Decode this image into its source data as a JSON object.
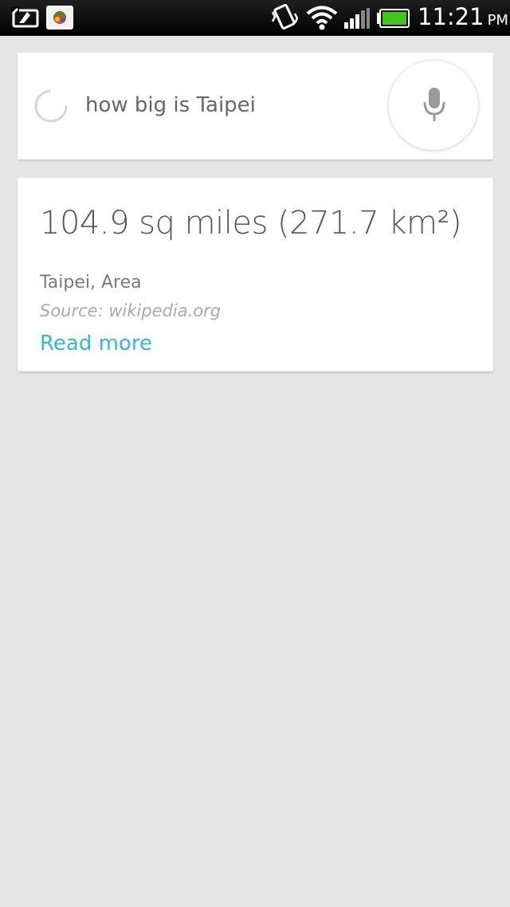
{
  "status_bar": {
    "time": "11:21",
    "ampm": "PM",
    "icons": [
      "screenshot-notification-icon",
      "app-notification-icon",
      "vibrate-icon",
      "wifi-icon",
      "signal-icon",
      "battery-icon"
    ],
    "battery_color": "#44c51a"
  },
  "search": {
    "query": "how big is Taipei",
    "mic_icon": "microphone-icon"
  },
  "answer": {
    "value": "104.9 sq miles (271.7 km²)",
    "label": "Taipei, Area",
    "source": "Source: wikipedia.org",
    "read_more": "Read more"
  },
  "colors": {
    "background": "#e5e5e5",
    "link": "#33b5e5",
    "status_bar": "#000000"
  }
}
